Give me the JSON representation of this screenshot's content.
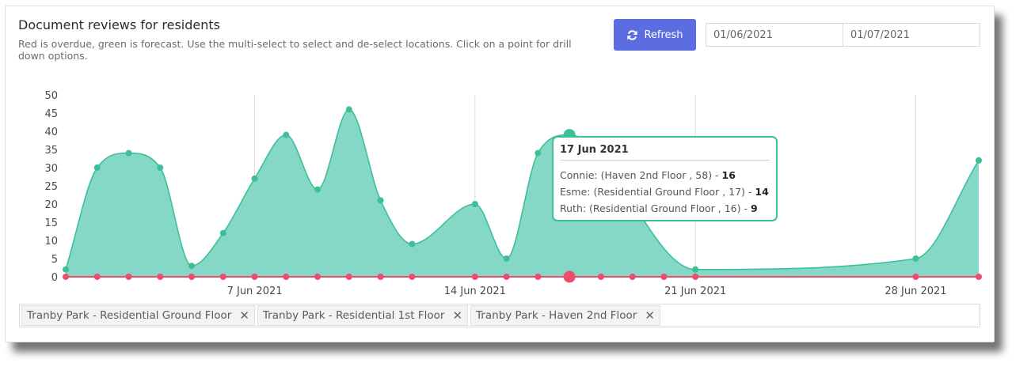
{
  "header": {
    "title": "Document reviews for residents",
    "subtitle": "Red is overdue, green is forecast. Use the multi-select to select and de-select locations. Click on a point for drill down options.",
    "refresh_label": "Refresh",
    "date_from": "01/06/2021",
    "date_to": "01/07/2021"
  },
  "colors": {
    "forecast_fill": "#84d8c5",
    "forecast_line": "#3dbf9a",
    "overdue": "#ef4b6c",
    "button": "#5b6de0"
  },
  "tooltip": {
    "date": "17 Jun 2021",
    "rows": [
      {
        "label": "Connie: (Haven 2nd Floor , 58) - ",
        "value": "16"
      },
      {
        "label": "Esme: (Residential Ground Floor , 17) - ",
        "value": "14"
      },
      {
        "label": "Ruth: (Residential Ground Floor , 16) - ",
        "value": "9"
      }
    ]
  },
  "multiselect": {
    "tags": [
      "Tranby Park - Residential Ground Floor",
      "Tranby Park - Residential 1st Floor",
      "Tranby Park - Haven 2nd Floor"
    ]
  },
  "chart_data": {
    "type": "area",
    "x": [
      "2021-06-01",
      "2021-06-02",
      "2021-06-03",
      "2021-06-04",
      "2021-06-05",
      "2021-06-06",
      "2021-06-07",
      "2021-06-08",
      "2021-06-09",
      "2021-06-10",
      "2021-06-11",
      "2021-06-12",
      "2021-06-14",
      "2021-06-15",
      "2021-06-16",
      "2021-06-17",
      "2021-06-21",
      "2021-06-28",
      "2021-06-30"
    ],
    "series": [
      {
        "values": [
          2,
          30,
          34,
          30,
          3,
          12,
          27,
          39,
          24,
          46,
          21,
          9,
          20,
          5,
          34,
          39,
          2,
          5,
          32
        ]
      },
      {
        "values": [
          0,
          0,
          0,
          0,
          0,
          0,
          0,
          0,
          0,
          0,
          0,
          0,
          0,
          0,
          0,
          0,
          0,
          0,
          0
        ]
      }
    ],
    "overdue_x": [
      "2021-06-01",
      "2021-06-02",
      "2021-06-03",
      "2021-06-04",
      "2021-06-05",
      "2021-06-06",
      "2021-06-07",
      "2021-06-08",
      "2021-06-09",
      "2021-06-10",
      "2021-06-11",
      "2021-06-12",
      "2021-06-14",
      "2021-06-15",
      "2021-06-16",
      "2021-06-17",
      "2021-06-18",
      "2021-06-19",
      "2021-06-20",
      "2021-06-21",
      "2021-06-28",
      "2021-06-30"
    ],
    "xticks": [
      "7 Jun 2021",
      "14 Jun 2021",
      "21 Jun 2021",
      "28 Jun 2021"
    ],
    "xtick_dates": [
      "2021-06-07",
      "2021-06-14",
      "2021-06-21",
      "2021-06-28"
    ],
    "yticks": [
      0,
      5,
      10,
      15,
      20,
      25,
      30,
      35,
      40,
      45,
      50
    ],
    "ylim": [
      0,
      50
    ],
    "xlim": [
      "2021-06-01",
      "2021-06-30"
    ],
    "highlight_date": "2021-06-17",
    "grid": "vertical-at-ticks"
  }
}
